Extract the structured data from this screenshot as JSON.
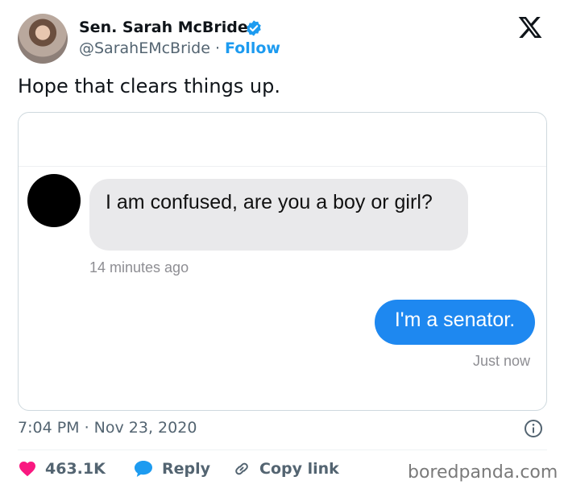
{
  "author": {
    "name": "Sen. Sarah McBride",
    "handle": "@SarahEMcBride",
    "separator": " · ",
    "follow_label": "Follow"
  },
  "tweet": {
    "text": "Hope that clears things up.",
    "timestamp": "7:04 PM · Nov 23, 2020"
  },
  "conversation": {
    "incoming": {
      "text": "I am confused, are you a boy or girl?",
      "time": "14 minutes ago"
    },
    "outgoing": {
      "text": "I'm a senator.",
      "time": "Just now"
    }
  },
  "actions": {
    "like_count": "463.1K",
    "reply_label": "Reply",
    "copy_label": "Copy link"
  },
  "watermark": "boredpanda.com",
  "colors": {
    "accent_blue": "#1d9bf0",
    "imessage_blue": "#1e88f0",
    "like_red": "#f91880",
    "muted_text": "#536471"
  },
  "icons": [
    "verified-badge-icon",
    "x-logo-icon",
    "info-icon",
    "heart-icon",
    "reply-bubble-icon",
    "link-icon"
  ]
}
